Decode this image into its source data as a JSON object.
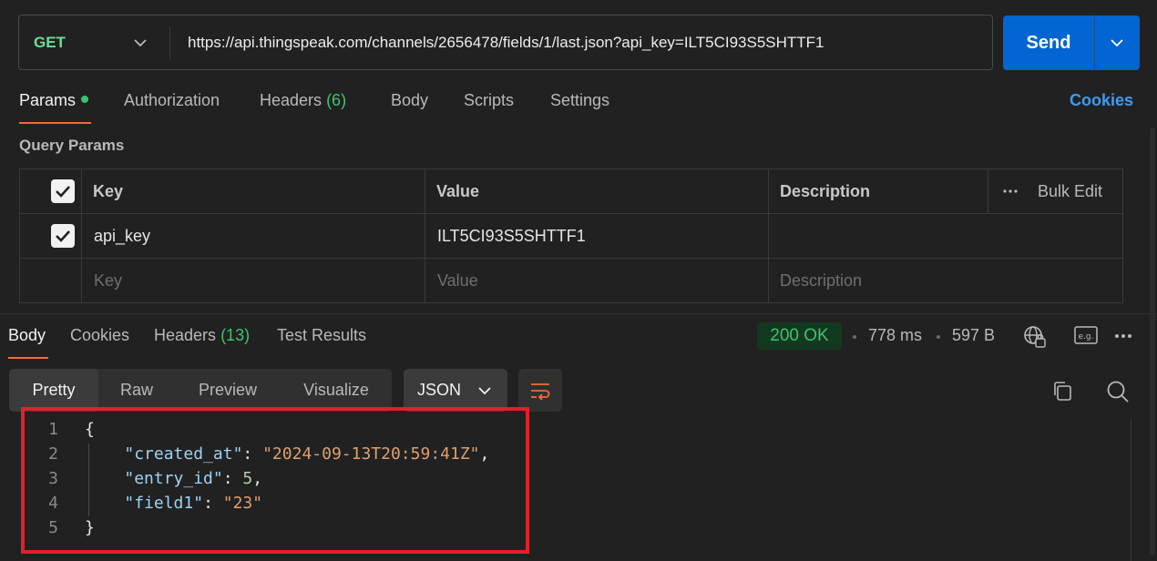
{
  "request": {
    "method": "GET",
    "url": "https://api.thingspeak.com/channels/2656478/fields/1/last.json?api_key=ILT5CI93S5SHTTF1",
    "send_label": "Send"
  },
  "request_tabs": {
    "params": "Params",
    "authorization": "Authorization",
    "headers": "Headers",
    "headers_count": "(6)",
    "body": "Body",
    "scripts": "Scripts",
    "settings": "Settings",
    "cookies": "Cookies"
  },
  "query_params": {
    "title": "Query Params",
    "headers": {
      "key": "Key",
      "value": "Value",
      "description": "Description",
      "bulk_edit": "Bulk Edit"
    },
    "rows": [
      {
        "key": "api_key",
        "value": "ILT5CI93S5SHTTF1",
        "description": "",
        "checked": true
      }
    ],
    "placeholder": {
      "key": "Key",
      "value": "Value",
      "description": "Description"
    }
  },
  "response_tabs": {
    "body": "Body",
    "cookies": "Cookies",
    "headers": "Headers",
    "headers_count": "(13)",
    "test_results": "Test Results"
  },
  "response_meta": {
    "status": "200 OK",
    "time": "778 ms",
    "size": "597 B"
  },
  "view_modes": {
    "pretty": "Pretty",
    "raw": "Raw",
    "preview": "Preview",
    "visualize": "Visualize",
    "format": "JSON"
  },
  "response_body": {
    "line_numbers": [
      "1",
      "2",
      "3",
      "4",
      "5"
    ],
    "open_brace": "{",
    "close_brace": "}",
    "created_at_key": "\"created_at\"",
    "created_at_value": "\"2024-09-13T20:59:41Z\"",
    "entry_id_key": "\"entry_id\"",
    "entry_id_value": "5",
    "field1_key": "\"field1\"",
    "field1_value": "\"23\""
  },
  "colors": {
    "accent": "#f26b3a",
    "send": "#0265d2",
    "status_ok": "#3cc46c",
    "highlight_box": "#e1212b"
  }
}
